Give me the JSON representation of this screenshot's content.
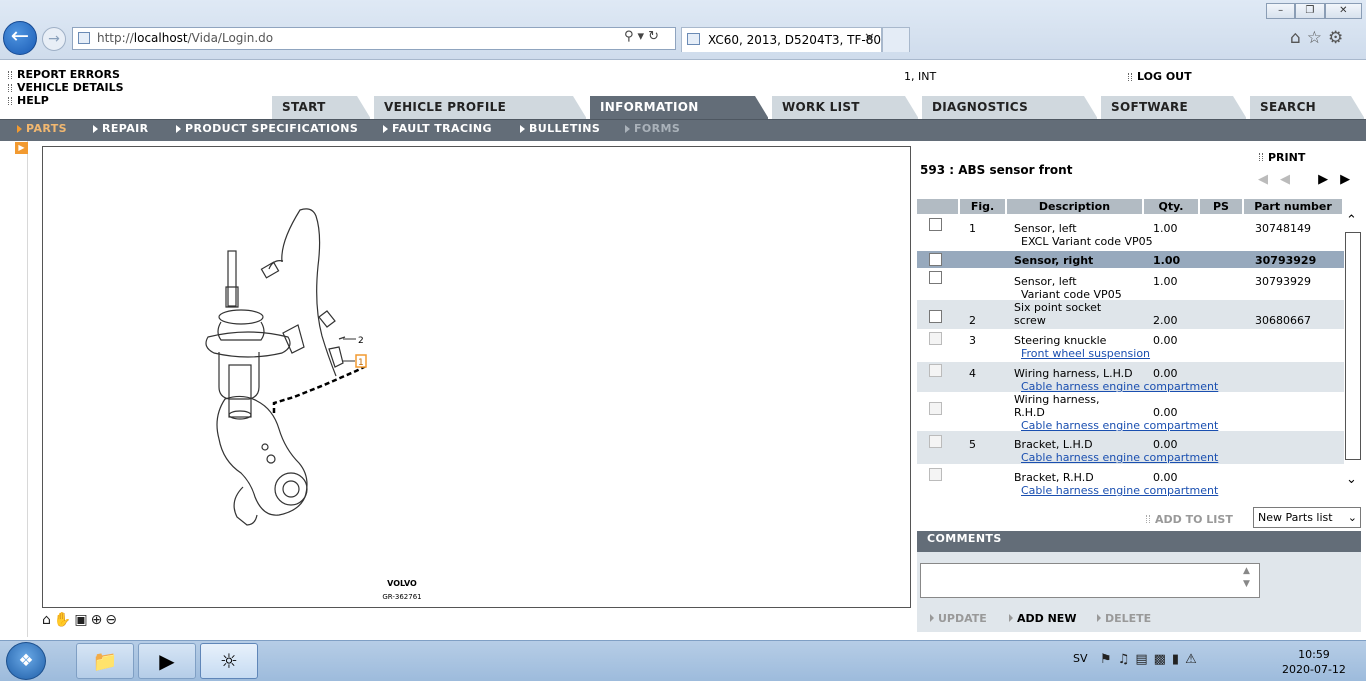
{
  "browser": {
    "url_prefix": "http://",
    "url_host": "localhost",
    "url_path": "/Vida/Login.do",
    "tab_title": "XC60, 2013, D5204T3, TF-80..."
  },
  "header": {
    "links": [
      "REPORT ERRORS",
      "VEHICLE DETAILS",
      "HELP"
    ],
    "user": "1, INT",
    "logout": "LOG OUT"
  },
  "main_tabs": [
    "START",
    "VEHICLE PROFILE",
    "INFORMATION",
    "WORK LIST",
    "DIAGNOSTICS",
    "SOFTWARE",
    "SEARCH"
  ],
  "active_main_tab": "INFORMATION",
  "sub_tabs": [
    "PARTS",
    "REPAIR",
    "PRODUCT SPECIFICATIONS",
    "FAULT TRACING",
    "BULLETINS",
    "FORMS"
  ],
  "illustration": {
    "callouts": [
      "2",
      "1"
    ],
    "brand": "VOLVO",
    "ref": "GR-362761"
  },
  "parts": {
    "title": "593 : ABS sensor front",
    "print": "PRINT",
    "columns": [
      "Fig.",
      "Description",
      "Qty.",
      "PS",
      "Part number"
    ],
    "rows": [
      {
        "fig": "1",
        "desc": "Sensor, left",
        "sub": "EXCL Variant code VP05",
        "sub_link": false,
        "qty": "1.00",
        "pn": "30748149"
      },
      {
        "fig": "",
        "desc": "Sensor, right",
        "sub": "",
        "sub_link": false,
        "qty": "1.00",
        "pn": "30793929"
      },
      {
        "fig": "",
        "desc": "Sensor, left",
        "sub": "Variant code VP05",
        "sub_link": false,
        "qty": "1.00",
        "pn": "30793929"
      },
      {
        "fig": "2",
        "desc": "Six point socket screw",
        "sub": "",
        "sub_link": false,
        "qty": "2.00",
        "pn": "30680667"
      },
      {
        "fig": "3",
        "desc": "Steering knuckle",
        "sub": "Front wheel suspension",
        "sub_link": true,
        "qty": "0.00",
        "pn": ""
      },
      {
        "fig": "4",
        "desc": "Wiring harness, L.H.D",
        "sub": "Cable harness engine compartment",
        "sub_link": true,
        "qty": "0.00",
        "pn": ""
      },
      {
        "fig": "",
        "desc": "Wiring harness, R.H.D",
        "sub": "Cable harness engine compartment",
        "sub_link": true,
        "qty": "0.00",
        "pn": ""
      },
      {
        "fig": "5",
        "desc": "Bracket, L.H.D",
        "sub": "Cable harness engine compartment",
        "sub_link": true,
        "qty": "0.00",
        "pn": ""
      },
      {
        "fig": "",
        "desc": "Bracket, R.H.D",
        "sub": "Cable harness engine compartment",
        "sub_link": true,
        "qty": "0.00",
        "pn": ""
      }
    ],
    "add_to_list": "ADD TO LIST",
    "list_select": "New Parts list"
  },
  "comments": {
    "title": "COMMENTS",
    "update": "UPDATE",
    "add_new": "ADD NEW",
    "delete": "DELETE"
  },
  "taskbar": {
    "lang": "SV",
    "time": "10:59",
    "date": "2020-07-12"
  },
  "colors": {
    "nav_dark": "#636d78",
    "row_selected": "#97a9bd",
    "row_alt": "#dfe5ea",
    "accent_orange": "#f29a30",
    "link": "#1a4fb0"
  }
}
